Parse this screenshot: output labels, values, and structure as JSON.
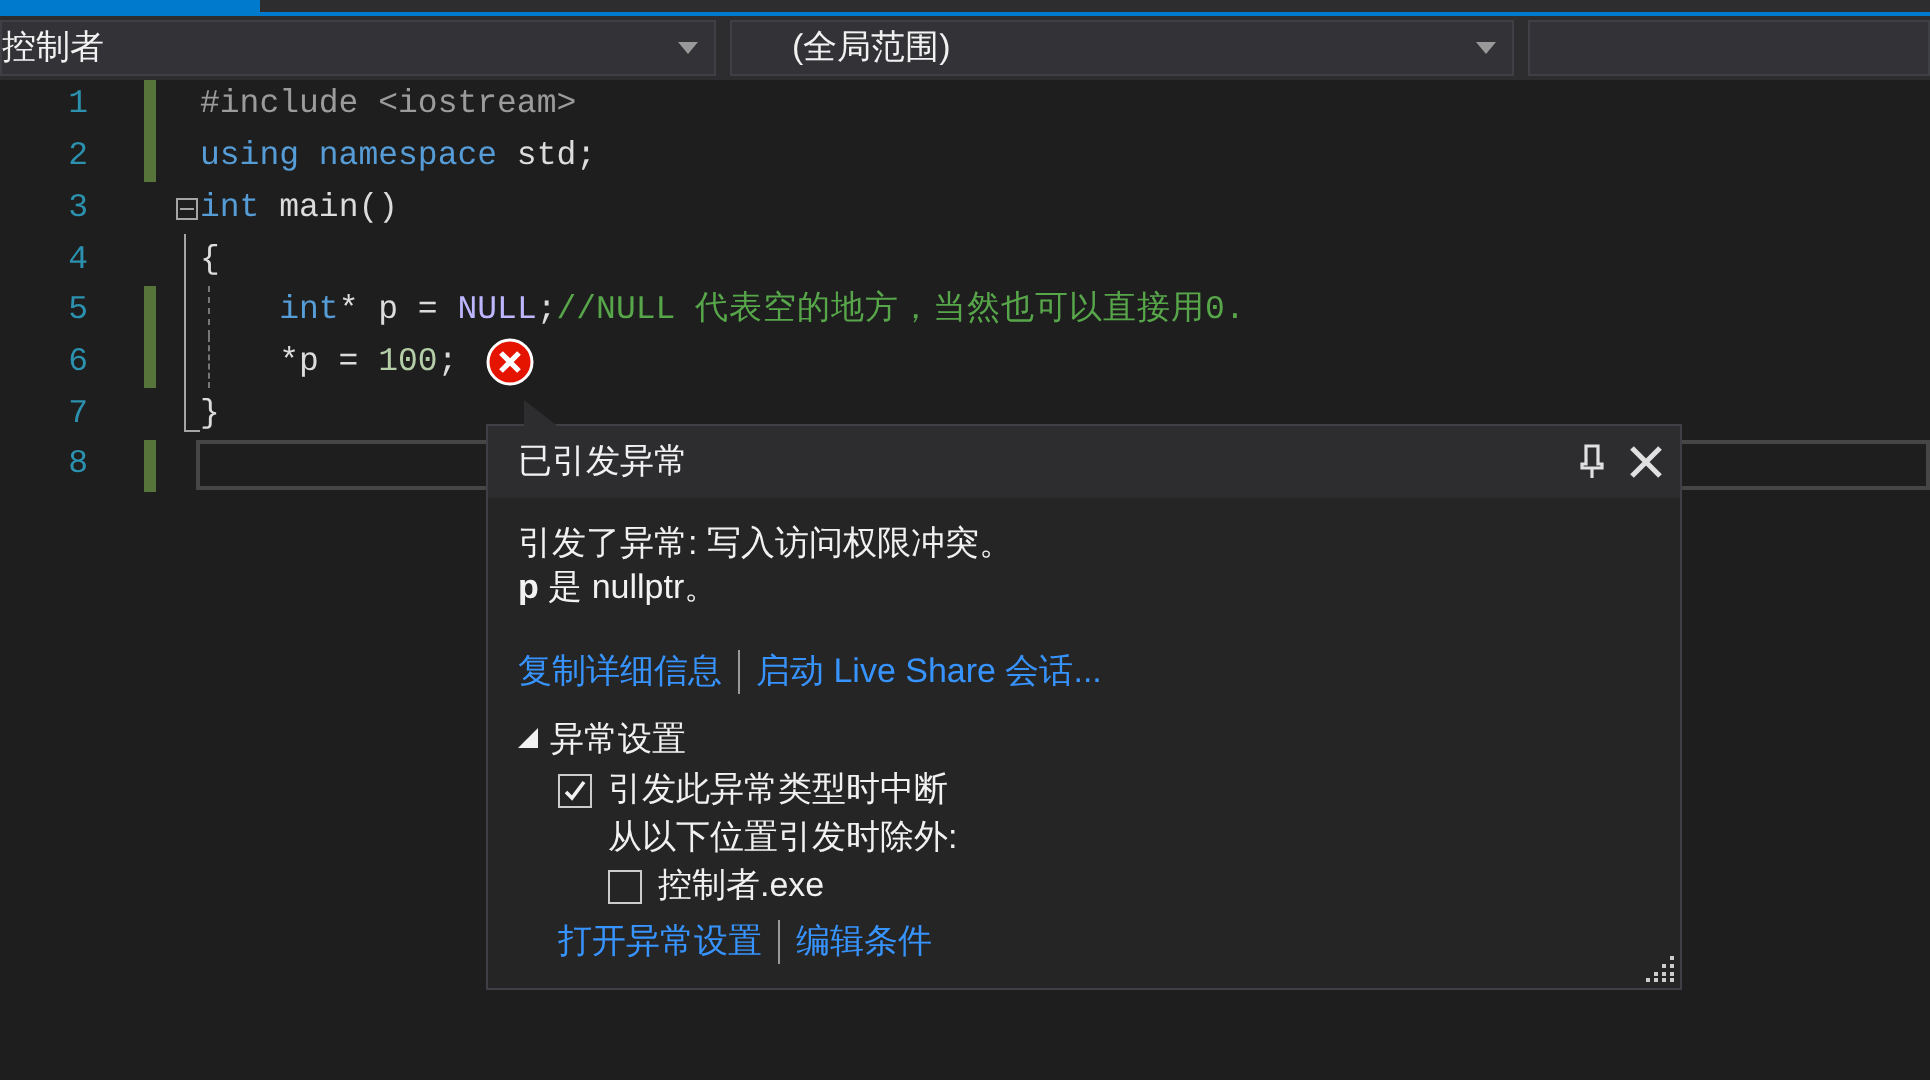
{
  "navigation_bar": {
    "dropdowns": [
      {
        "value": "控制者"
      },
      {
        "value": "(全局范围)"
      }
    ]
  },
  "editor": {
    "lines": [
      {
        "number": "1",
        "changed": true,
        "tokens": [
          {
            "kind": "preprocessor",
            "text": "#include <iostream>"
          }
        ]
      },
      {
        "number": "2",
        "changed": true,
        "tokens": [
          {
            "kind": "keyword",
            "text": "using namespace"
          },
          {
            "kind": "plain",
            "text": " std;"
          }
        ]
      },
      {
        "number": "3",
        "changed": false,
        "expanded": true,
        "tokens": [
          {
            "kind": "keyword",
            "text": "int"
          },
          {
            "kind": "plain",
            "text": " main()"
          }
        ]
      },
      {
        "number": "4",
        "changed": false,
        "kind": "block",
        "tokens": [
          {
            "kind": "plain",
            "text": "{"
          }
        ]
      },
      {
        "number": "5",
        "changed": true,
        "kind": "block-guide",
        "tokens": [
          {
            "kind": "keyword",
            "text": "    int"
          },
          {
            "kind": "plain",
            "text": "* p = "
          },
          {
            "kind": "macro",
            "text": "NULL"
          },
          {
            "kind": "plain",
            "text": ";"
          },
          {
            "kind": "comment",
            "text": "//NULL 代表空的地方，当然也可以直接用0."
          }
        ]
      },
      {
        "number": "6",
        "changed": true,
        "kind": "block-guide",
        "error": true,
        "tokens": [
          {
            "kind": "plain",
            "text": "    *p = "
          },
          {
            "kind": "number",
            "text": "100"
          },
          {
            "kind": "plain",
            "text": ";"
          }
        ]
      },
      {
        "number": "7",
        "changed": false,
        "kind": "block-end",
        "tokens": [
          {
            "kind": "plain",
            "text": "}"
          }
        ]
      },
      {
        "number": "8",
        "changed": true,
        "current": true
      }
    ]
  },
  "exception_popup": {
    "title": "已引发异常",
    "message": [
      "引发了异常: 写入访问权限冲突。",
      "**p** 是 nullptr。"
    ],
    "links": [
      "复制详细信息",
      "启动 Live Share 会话..."
    ],
    "settings": {
      "title": "异常设置",
      "expanded": true,
      "break_option": {
        "label": "引发此异常类型时中断",
        "checked": true
      },
      "except_label": "从以下位置引发时除外:",
      "modules": [
        {
          "label": "控制者.exe",
          "checked": false
        }
      ],
      "links": [
        "打开异常设置",
        "编辑条件"
      ]
    }
  }
}
